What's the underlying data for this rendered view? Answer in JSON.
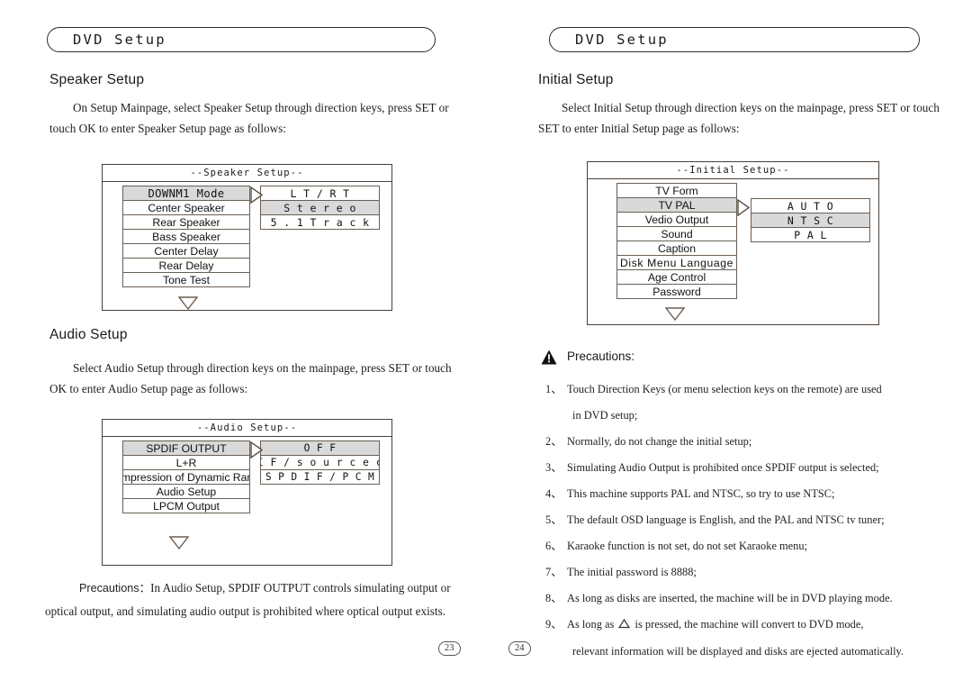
{
  "left_page": {
    "banner_title": "DVD Setup",
    "section1": {
      "heading": "Speaker Setup",
      "paragraph": "On Setup Mainpage, select Speaker Setup through direction keys, press SET or touch OK to enter Speaker Setup page as follows:",
      "menu": {
        "title": "--Speaker Setup--",
        "items": [
          {
            "label": "DOWNM1 Mode",
            "selected": true
          },
          {
            "label": "Center Speaker",
            "selected": false
          },
          {
            "label": "Rear Speaker",
            "selected": false
          },
          {
            "label": "Bass Speaker",
            "selected": false
          },
          {
            "label": "Center Delay",
            "selected": false
          },
          {
            "label": "Rear Delay",
            "selected": false
          },
          {
            "label": "Tone Test",
            "selected": false
          }
        ],
        "options": [
          {
            "label": "L T / R T",
            "selected": false
          },
          {
            "label": "S t e r e o",
            "selected": true
          },
          {
            "label": "5 . 1 T r a c k",
            "selected": false
          }
        ]
      }
    },
    "section2": {
      "heading": "Audio Setup",
      "paragraph": "Select Audio Setup through direction keys on the mainpage, press SET or touch OK to enter Audio Setup page as follows:",
      "menu": {
        "title": "--Audio Setup--",
        "items": [
          {
            "label": "SPDIF OUTPUT",
            "selected": true
          },
          {
            "label": "L+R",
            "selected": false
          },
          {
            "label": "Compression of Dynamic Range",
            "selected": false
          },
          {
            "label": "Audio Setup",
            "selected": false
          },
          {
            "label": "LPCM Output",
            "selected": false
          }
        ],
        "options": [
          {
            "label": "O F F",
            "selected": true
          },
          {
            "label": "S P D I F / s o u r c e  c o d e",
            "selected": false
          },
          {
            "label": "S P D I F / P C M",
            "selected": false
          }
        ]
      }
    },
    "footnote": {
      "lead": "Precautions：",
      "text": "In Audio Setup, SPDIF OUTPUT controls simulating output or optical output, and simulating audio output is prohibited where optical output exists."
    },
    "page_number": "23"
  },
  "right_page": {
    "banner_title": "DVD Setup",
    "section1": {
      "heading": "Initial Setup",
      "paragraph": "Select Initial Setup through direction keys on the mainpage, press SET or touch SET to enter Initial Setup page as follows:",
      "menu": {
        "title": "--Initial Setup--",
        "items": [
          {
            "label": "TV Form",
            "selected": false
          },
          {
            "label": "TV PAL",
            "selected": true
          },
          {
            "label": "Vedio Output",
            "selected": false
          },
          {
            "label": "Sound",
            "selected": false
          },
          {
            "label": "Caption",
            "selected": false
          },
          {
            "label": "Disk Menu Language",
            "selected": false
          },
          {
            "label": "Age Control",
            "selected": false
          },
          {
            "label": "Password",
            "selected": false
          }
        ],
        "options": [
          {
            "label": "A U T O",
            "selected": false
          },
          {
            "label": "N T S C",
            "selected": true
          },
          {
            "label": "P A L",
            "selected": false
          }
        ]
      }
    },
    "precautions": {
      "heading": "Precautions:",
      "items": [
        {
          "num": "1、",
          "text": "Touch Direction Keys (or menu selection keys on the remote) are used",
          "cont": "in DVD setup;"
        },
        {
          "num": "2、",
          "text": "Normally, do not change the initial setup;",
          "cont": ""
        },
        {
          "num": "3、",
          "text": "Simulating Audio Output is prohibited once SPDIF output is selected;",
          "cont": ""
        },
        {
          "num": "4、",
          "text": "This machine supports PAL and NTSC, so try to use NTSC;",
          "cont": ""
        },
        {
          "num": "5、",
          "text": "The default OSD language is English, and the  PAL and  NTSC tv tuner;",
          "cont": ""
        },
        {
          "num": "6、",
          "text": "Karaoke function is not set, do not set Karaoke menu;",
          "cont": ""
        },
        {
          "num": "7、",
          "text": "The initial password is 8888;",
          "cont": ""
        },
        {
          "num": "8、",
          "text": "As long as disks are inserted, the machine will be in DVD playing mode.",
          "cont": ""
        },
        {
          "num": "9、",
          "text_before": "As long as",
          "has_triangle": true,
          "text_after": "is pressed, the machine will convert to DVD mode,",
          "cont": "relevant information will be displayed and disks are ejected automatically."
        }
      ]
    },
    "page_number": "24"
  },
  "colors": {
    "selected_row": "#d9d9d9",
    "border": "#6b5f54",
    "panel_border": "#4a4038",
    "text": "#1a1a1a"
  }
}
